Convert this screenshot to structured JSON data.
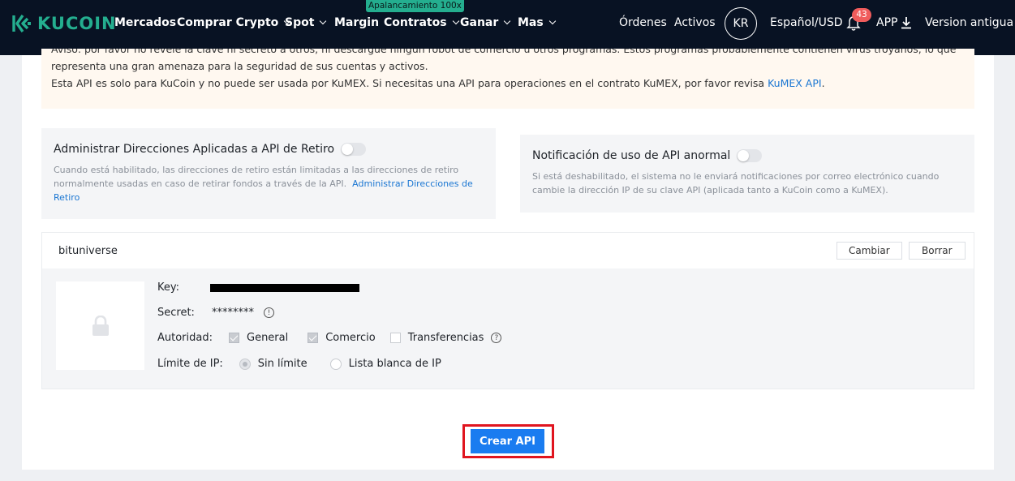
{
  "colors": {
    "nav_bg": "#081223",
    "brand": "#24ae8f",
    "primary": "#1a7cf0",
    "link": "#1a76d2",
    "badge": "#f05c5c",
    "highlight_border": "#e0151f"
  },
  "nav": {
    "logo_text": "KUCOIN",
    "items": [
      {
        "label": "Mercados",
        "dropdown": false
      },
      {
        "label": "Comprar Crypto",
        "dropdown": true
      },
      {
        "label": "Spot",
        "dropdown": true
      },
      {
        "label": "Margin",
        "dropdown": false
      },
      {
        "label": "Contratos",
        "dropdown": true
      },
      {
        "label": "Ganar",
        "dropdown": true
      },
      {
        "label": "Mas",
        "dropdown": true
      }
    ],
    "promo_badge": "Apalancamiento 100x",
    "orders": "Órdenes",
    "assets": "Activos",
    "avatar": "KR",
    "language": "Español/USD",
    "notifications": "43",
    "app": "APP",
    "old_version": "Version antigua"
  },
  "notice": {
    "line1": "Aviso: por favor no revele la clave ni secreto a otros, ni descargue ningún robot de comercio u otros programas. Estos programas probablemente contienen virus troyanos, lo que",
    "line2": "representa una gran amenaza para la seguridad de sus cuentas y activos.",
    "line3": "Esta API es solo para KuCoin y no puede ser usada por KuMEX. Si necesitas una API para operaciones en el contrato KuMEX, por favor revisa ",
    "line3_link": "KuMEX API",
    "line3_end": "."
  },
  "withdraw_option": {
    "title": "Administrar Direcciones Aplicadas a API de Retiro",
    "enabled": false,
    "desc": "Cuando está habilitado, las direcciones de retiro están limitadas a las direcciones de retiro normalmente usadas en caso de retirar fondos a través de la API.",
    "link": "Administrar Direcciones de Retiro"
  },
  "abnormal_option": {
    "title": "Notificación de uso de API anormal",
    "enabled": false,
    "desc": "Si está deshabilitado, el sistema no le enviará notificaciones por correo electrónico cuando cambie la dirección IP de su clave API (aplicada tanto a KuCoin como a KuMEX)."
  },
  "api": {
    "name": "bituniverse",
    "change_label": "Cambiar",
    "delete_label": "Borrar",
    "key_label": "Key:",
    "secret_label": "Secret:",
    "secret_value": "********",
    "authority_label": "Autoridad:",
    "permissions": [
      {
        "label": "General",
        "checked": true
      },
      {
        "label": "Comercio",
        "checked": true
      },
      {
        "label": "Transferencias",
        "checked": false
      }
    ],
    "ip_limit_label": "Límite de IP:",
    "ip_options": [
      {
        "label": "Sin límite",
        "selected": true
      },
      {
        "label": "Lista blanca de IP",
        "selected": false
      }
    ]
  },
  "create_button": "Crear API"
}
